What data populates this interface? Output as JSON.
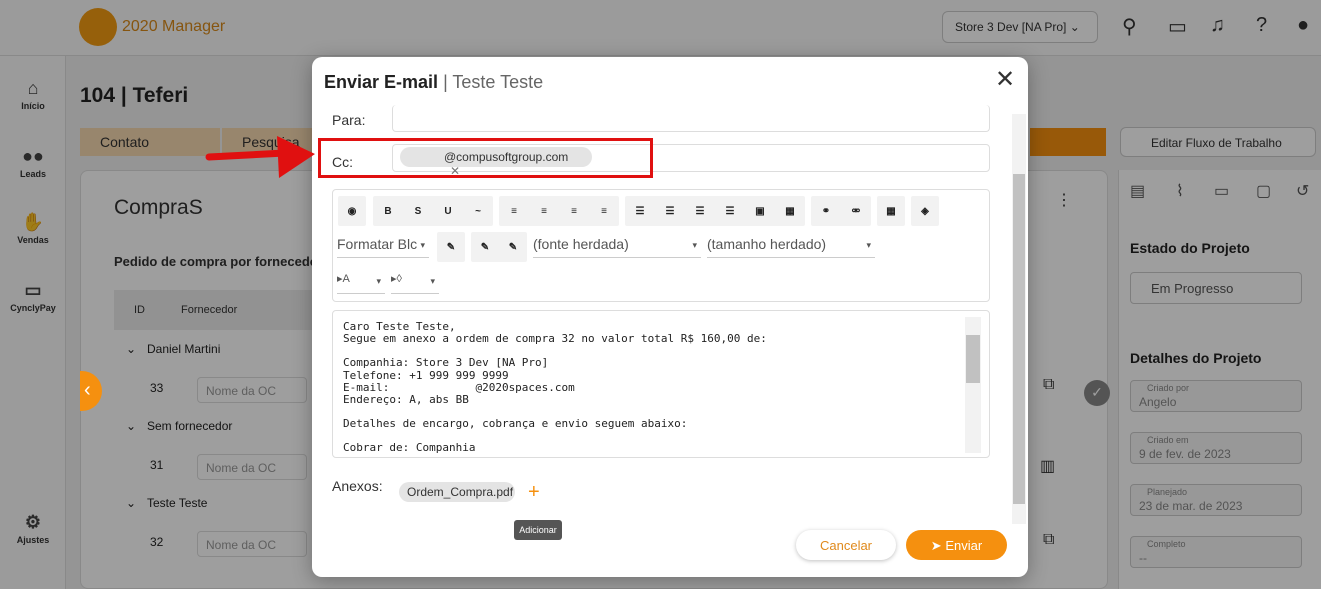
{
  "app": {
    "name": "2020 Manager",
    "store_selector": "Store 3 Dev [NA Pro]",
    "page_title": "104 | Teferi"
  },
  "nav": [
    {
      "label": "Início",
      "icon": "home-icon"
    },
    {
      "label": "Leads",
      "icon": "people-icon"
    },
    {
      "label": "Vendas",
      "icon": "handshake-icon"
    },
    {
      "label": "CynclyPay",
      "icon": "card-icon"
    },
    {
      "label": "Ajustes",
      "icon": "gear-icon"
    }
  ],
  "tabs": [
    "Contato",
    "Pesquisa"
  ],
  "flow_button": "Editar Fluxo de Trabalho",
  "section": {
    "title": "CompraS",
    "subtitle": "Pedido de compra por fornecedo",
    "col_id": "ID",
    "col_supplier": "Fornecedor",
    "groups": [
      {
        "name": "Daniel Martini",
        "id": "33",
        "placeholder": "Nome da OC"
      },
      {
        "name": "Sem fornecedor",
        "id": "31",
        "placeholder": "Nome da OC"
      },
      {
        "name": "Teste Teste",
        "id": "32",
        "placeholder": "Nome da OC"
      }
    ]
  },
  "right_panel": {
    "project_state_title": "Estado do Projeto",
    "project_state_value": "Em Progresso",
    "details_title": "Detalhes do Projeto",
    "created_by_label": "Criado por",
    "created_by": "Angelo",
    "created_on_label": "Criado em",
    "created_on": "9 de fev. de 2023",
    "planned_label": "Planejado",
    "planned": "23 de mar. de 2023",
    "completed_label": "Completo",
    "completed": "--"
  },
  "modal": {
    "title": "Enviar E-mail",
    "subtitle": "| Teste Teste",
    "to_label": "Para:",
    "cc_label": "Cc:",
    "cc_chip": "@compusoftgroup.com",
    "format_block": "Formatar Blc",
    "font_family": "(fonte herdada)",
    "font_size": "(tamanho herdado)",
    "body_lines": [
      "Caro Teste Teste,",
      "Segue em anexo a ordem de compra 32 no valor total R$ 160,00 de:",
      "",
      "Companhia: Store 3 Dev [NA Pro]",
      "Telefone: +1 999 999 9999",
      "E-mail:             @2020spaces.com",
      "Endereço: A, abs BB",
      "",
      "Detalhes de encargo, cobrança e envio seguem abaixo:",
      "",
      "Cobrar de: Companhia"
    ],
    "attachments_label": "Anexos:",
    "attachment": "Ordem_Compra.pdf",
    "add_tooltip": "Adicionar",
    "cancel": "Cancelar",
    "send": "Enviar"
  },
  "colors": {
    "accent": "#f5900f",
    "annotation": "#e01010"
  }
}
